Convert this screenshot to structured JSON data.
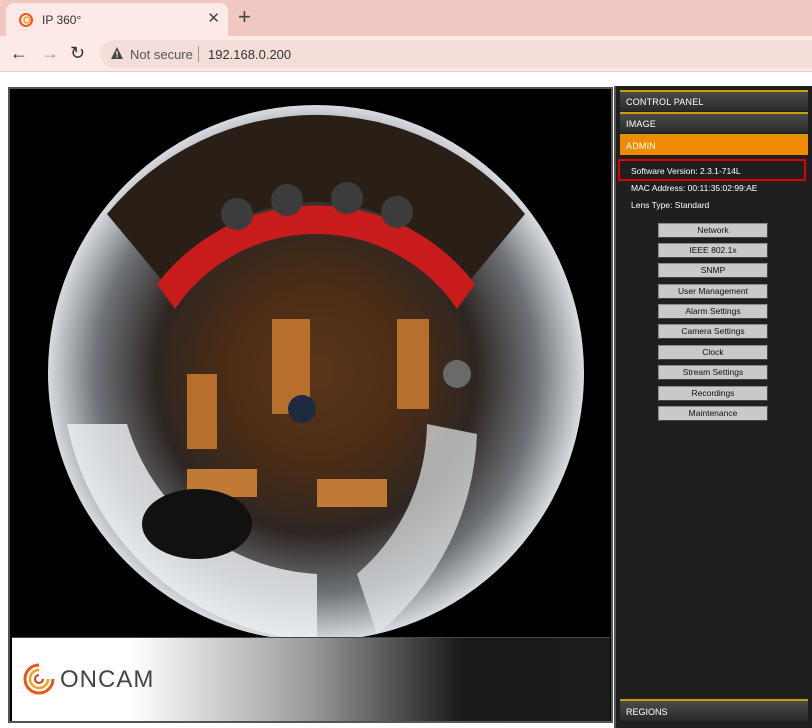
{
  "browser": {
    "tab_title": "IP 360°",
    "tab_close": "✕",
    "new_tab": "+",
    "back": "←",
    "forward": "→",
    "reload": "↻",
    "security_label": "Not secure",
    "url": "192.168.0.200"
  },
  "sidebar": {
    "control_panel": "CONTROL PANEL",
    "image": "IMAGE",
    "admin": "ADMIN",
    "software_version": "Software Version:  2.3.1-714L",
    "mac_address": "MAC Address:  00:11:35:02:99:AE",
    "lens_type": "Lens Type:  Standard",
    "buttons": [
      "Network",
      "IEEE 802.1x",
      "SNMP",
      "User Management",
      "Alarm Settings",
      "Camera Settings",
      "Clock",
      "Stream Settings",
      "Recordings",
      "Maintenance"
    ],
    "regions": "REGIONS"
  },
  "video": {
    "logo_text": "ONCAM"
  },
  "colors": {
    "accent": "#f08a00",
    "highlight_border": "#e00000",
    "tab_strip": "#f1c7c1"
  }
}
